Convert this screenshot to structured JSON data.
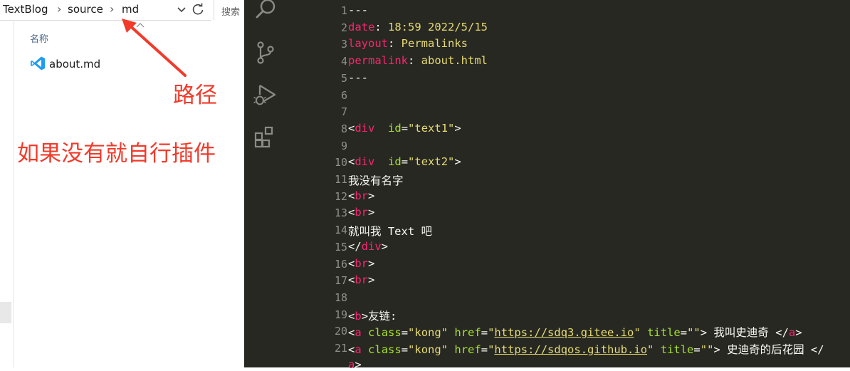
{
  "explorer": {
    "breadcrumb": [
      "TextBlog",
      "source",
      "md"
    ],
    "search_placeholder": "搜索",
    "column_name": "名称",
    "files": [
      {
        "name": "about.md",
        "icon": "vscode-icon"
      }
    ]
  },
  "annotations": {
    "path_label": "路径",
    "plugin_note": "如果没有就自行插件",
    "color": "#f23a2a"
  },
  "editor": {
    "theme": {
      "background": "#272822",
      "keyword": "#f92672",
      "string": "#e6db74",
      "attribute": "#a6e22e",
      "text": "#f8f8f2",
      "line_number": "#90908a"
    },
    "activity_icons": [
      "search-icon",
      "source-control-icon",
      "run-debug-icon",
      "extensions-icon"
    ],
    "line_numbers": [
      "1",
      "2",
      "3",
      "4",
      "5",
      "6",
      "7",
      "8",
      "9",
      "10",
      "11",
      "12",
      "13",
      "14",
      "15",
      "16",
      "17",
      "18",
      "19",
      "20",
      "21"
    ],
    "lines": [
      [
        {
          "t": "---"
        }
      ],
      [
        {
          "t": "date",
          "c": "k"
        },
        {
          "t": ": "
        },
        {
          "t": "18:59 2022/5/15",
          "c": "s"
        }
      ],
      [
        {
          "t": "layout",
          "c": "k"
        },
        {
          "t": ": "
        },
        {
          "t": "Permalinks",
          "c": "s"
        }
      ],
      [
        {
          "t": "permalink",
          "c": "k"
        },
        {
          "t": ": "
        },
        {
          "t": "about.html",
          "c": "s"
        }
      ],
      [
        {
          "t": "---"
        }
      ],
      [],
      [],
      [
        {
          "t": "<"
        },
        {
          "t": "div",
          "c": "k"
        },
        {
          "t": "  "
        },
        {
          "t": "id",
          "c": "a"
        },
        {
          "t": "="
        },
        {
          "t": "\"text1\"",
          "c": "s"
        },
        {
          "t": ">"
        }
      ],
      [],
      [
        {
          "t": "<"
        },
        {
          "t": "div",
          "c": "k"
        },
        {
          "t": "  "
        },
        {
          "t": "id",
          "c": "a"
        },
        {
          "t": "="
        },
        {
          "t": "\"text2\"",
          "c": "s"
        },
        {
          "t": ">"
        }
      ],
      [
        {
          "t": "我没有名字"
        }
      ],
      [
        {
          "t": "<"
        },
        {
          "t": "br",
          "c": "k"
        },
        {
          "t": ">"
        }
      ],
      [
        {
          "t": "<"
        },
        {
          "t": "br",
          "c": "k"
        },
        {
          "t": ">"
        }
      ],
      [
        {
          "t": "就叫我 Text 吧"
        }
      ],
      [
        {
          "t": "</"
        },
        {
          "t": "div",
          "c": "k"
        },
        {
          "t": ">"
        }
      ],
      [
        {
          "t": "<"
        },
        {
          "t": "br",
          "c": "k"
        },
        {
          "t": ">"
        }
      ],
      [
        {
          "t": "<"
        },
        {
          "t": "br",
          "c": "k"
        },
        {
          "t": ">"
        }
      ],
      [],
      [
        {
          "t": "<"
        },
        {
          "t": "b",
          "c": "k"
        },
        {
          "t": ">友链:"
        }
      ],
      [
        {
          "t": "<"
        },
        {
          "t": "a",
          "c": "k"
        },
        {
          "t": " "
        },
        {
          "t": "class",
          "c": "a"
        },
        {
          "t": "="
        },
        {
          "t": "\"kong\"",
          "c": "s"
        },
        {
          "t": " "
        },
        {
          "t": "href",
          "c": "a"
        },
        {
          "t": "="
        },
        {
          "t": "\"",
          "c": "s"
        },
        {
          "t": "https://sdq3.gitee.io",
          "c": "u"
        },
        {
          "t": "\"",
          "c": "s"
        },
        {
          "t": " "
        },
        {
          "t": "title",
          "c": "a"
        },
        {
          "t": "="
        },
        {
          "t": "\"\"",
          "c": "s"
        },
        {
          "t": "> 我叫史迪奇 </"
        },
        {
          "t": "a",
          "c": "k"
        },
        {
          "t": ">"
        }
      ],
      [
        {
          "t": "<"
        },
        {
          "t": "a",
          "c": "k"
        },
        {
          "t": " "
        },
        {
          "t": "class",
          "c": "a"
        },
        {
          "t": "="
        },
        {
          "t": "\"kong\"",
          "c": "s"
        },
        {
          "t": " "
        },
        {
          "t": "href",
          "c": "a"
        },
        {
          "t": "="
        },
        {
          "t": "\"",
          "c": "s"
        },
        {
          "t": "https://sdqos.github.io",
          "c": "u"
        },
        {
          "t": "\"",
          "c": "s"
        },
        {
          "t": " "
        },
        {
          "t": "title",
          "c": "a"
        },
        {
          "t": "="
        },
        {
          "t": "\"\"",
          "c": "s"
        },
        {
          "t": "> 史迪奇的后花园 </"
        }
      ],
      [
        {
          "t": "a",
          "c": "k"
        },
        {
          "t": ">"
        }
      ]
    ]
  }
}
